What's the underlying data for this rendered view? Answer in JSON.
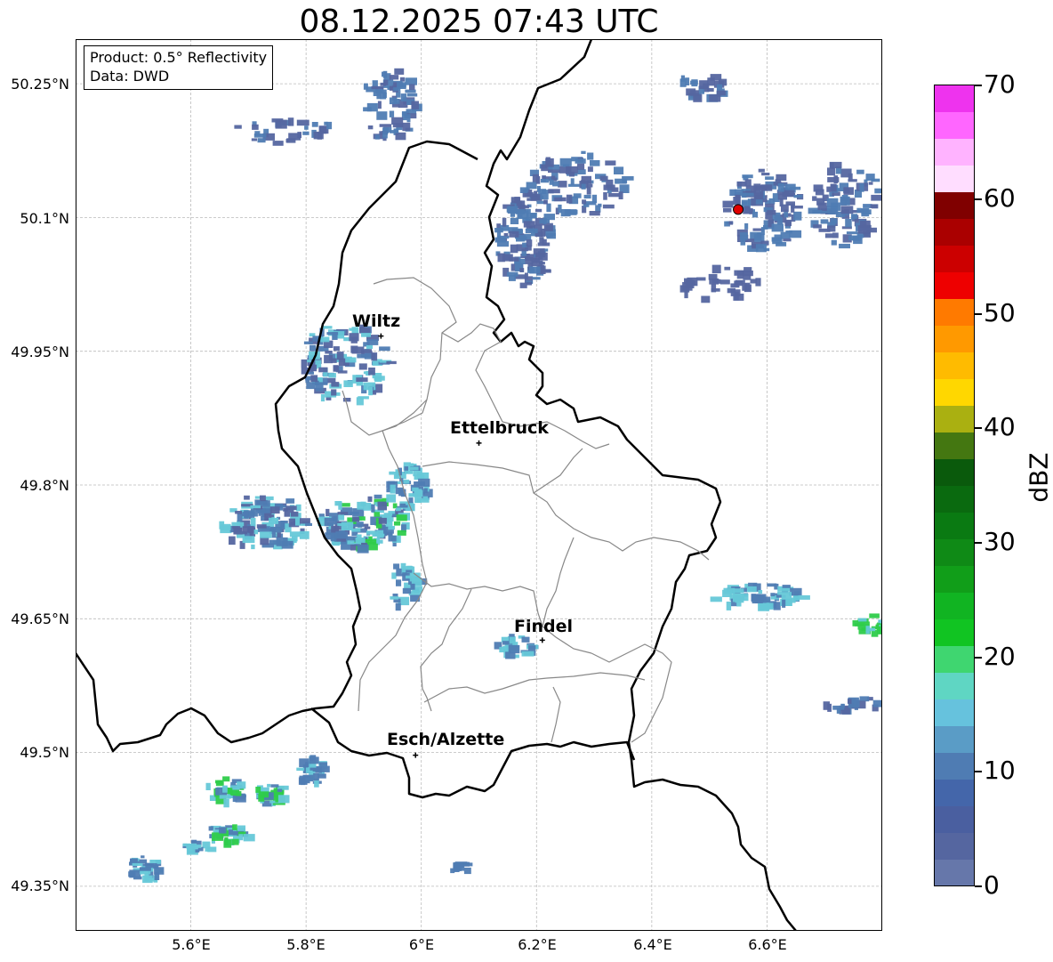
{
  "title": "08.12.2025 07:43 UTC",
  "info": {
    "product": "Product: 0.5° Reflectivity",
    "data": "Data: DWD"
  },
  "axes": {
    "lon_range": [
      5.4,
      6.8
    ],
    "lat_range": [
      49.3,
      50.3
    ],
    "x_ticks": [
      "5.6°E",
      "5.8°E",
      "6°E",
      "6.2°E",
      "6.4°E",
      "6.6°E"
    ],
    "y_ticks": [
      "50.25°N",
      "50.1°N",
      "49.95°N",
      "49.8°N",
      "49.65°N",
      "49.5°N",
      "49.35°N"
    ],
    "grid": true
  },
  "cities": [
    {
      "name": "Wiltz",
      "lon": 5.93,
      "lat": 49.967
    },
    {
      "name": "Ettelbruck",
      "lon": 6.1,
      "lat": 49.847
    },
    {
      "name": "Findel",
      "lon": 6.21,
      "lat": 49.626
    },
    {
      "name": "Esch/Alzette",
      "lon": 5.99,
      "lat": 49.497
    }
  ],
  "radar_site": {
    "lon": 6.55,
    "lat": 50.109,
    "color": "#e00000"
  },
  "colorbar": {
    "unit": "dBZ",
    "min": 0,
    "max": 70,
    "labels": [
      "0",
      "10",
      "20",
      "30",
      "40",
      "50",
      "60",
      "70"
    ],
    "colors": [
      "#6677aa",
      "#5566a0",
      "#4a5fa0",
      "#4466aa",
      "#4f7cb3",
      "#5a9cc6",
      "#66c2dd",
      "#5fd6c3",
      "#3fd670",
      "#11c422",
      "#11b422",
      "#119e19",
      "#0f8a16",
      "#0a7a12",
      "#0a6a0f",
      "#0a5a0c",
      "#447711",
      "#aab011",
      "#ffd700",
      "#ffbb00",
      "#ff9900",
      "#ff7a00",
      "#ee0000",
      "#cc0000",
      "#aa0000",
      "#800000",
      "#ffddff",
      "#ffb3ff",
      "#ff66ff",
      "#ee33ee"
    ]
  },
  "echo_colors": {
    "weak": "#5566a0",
    "mid": "#4f7cb3",
    "cyan": "#66c8d8",
    "green": "#2ecc4a"
  }
}
